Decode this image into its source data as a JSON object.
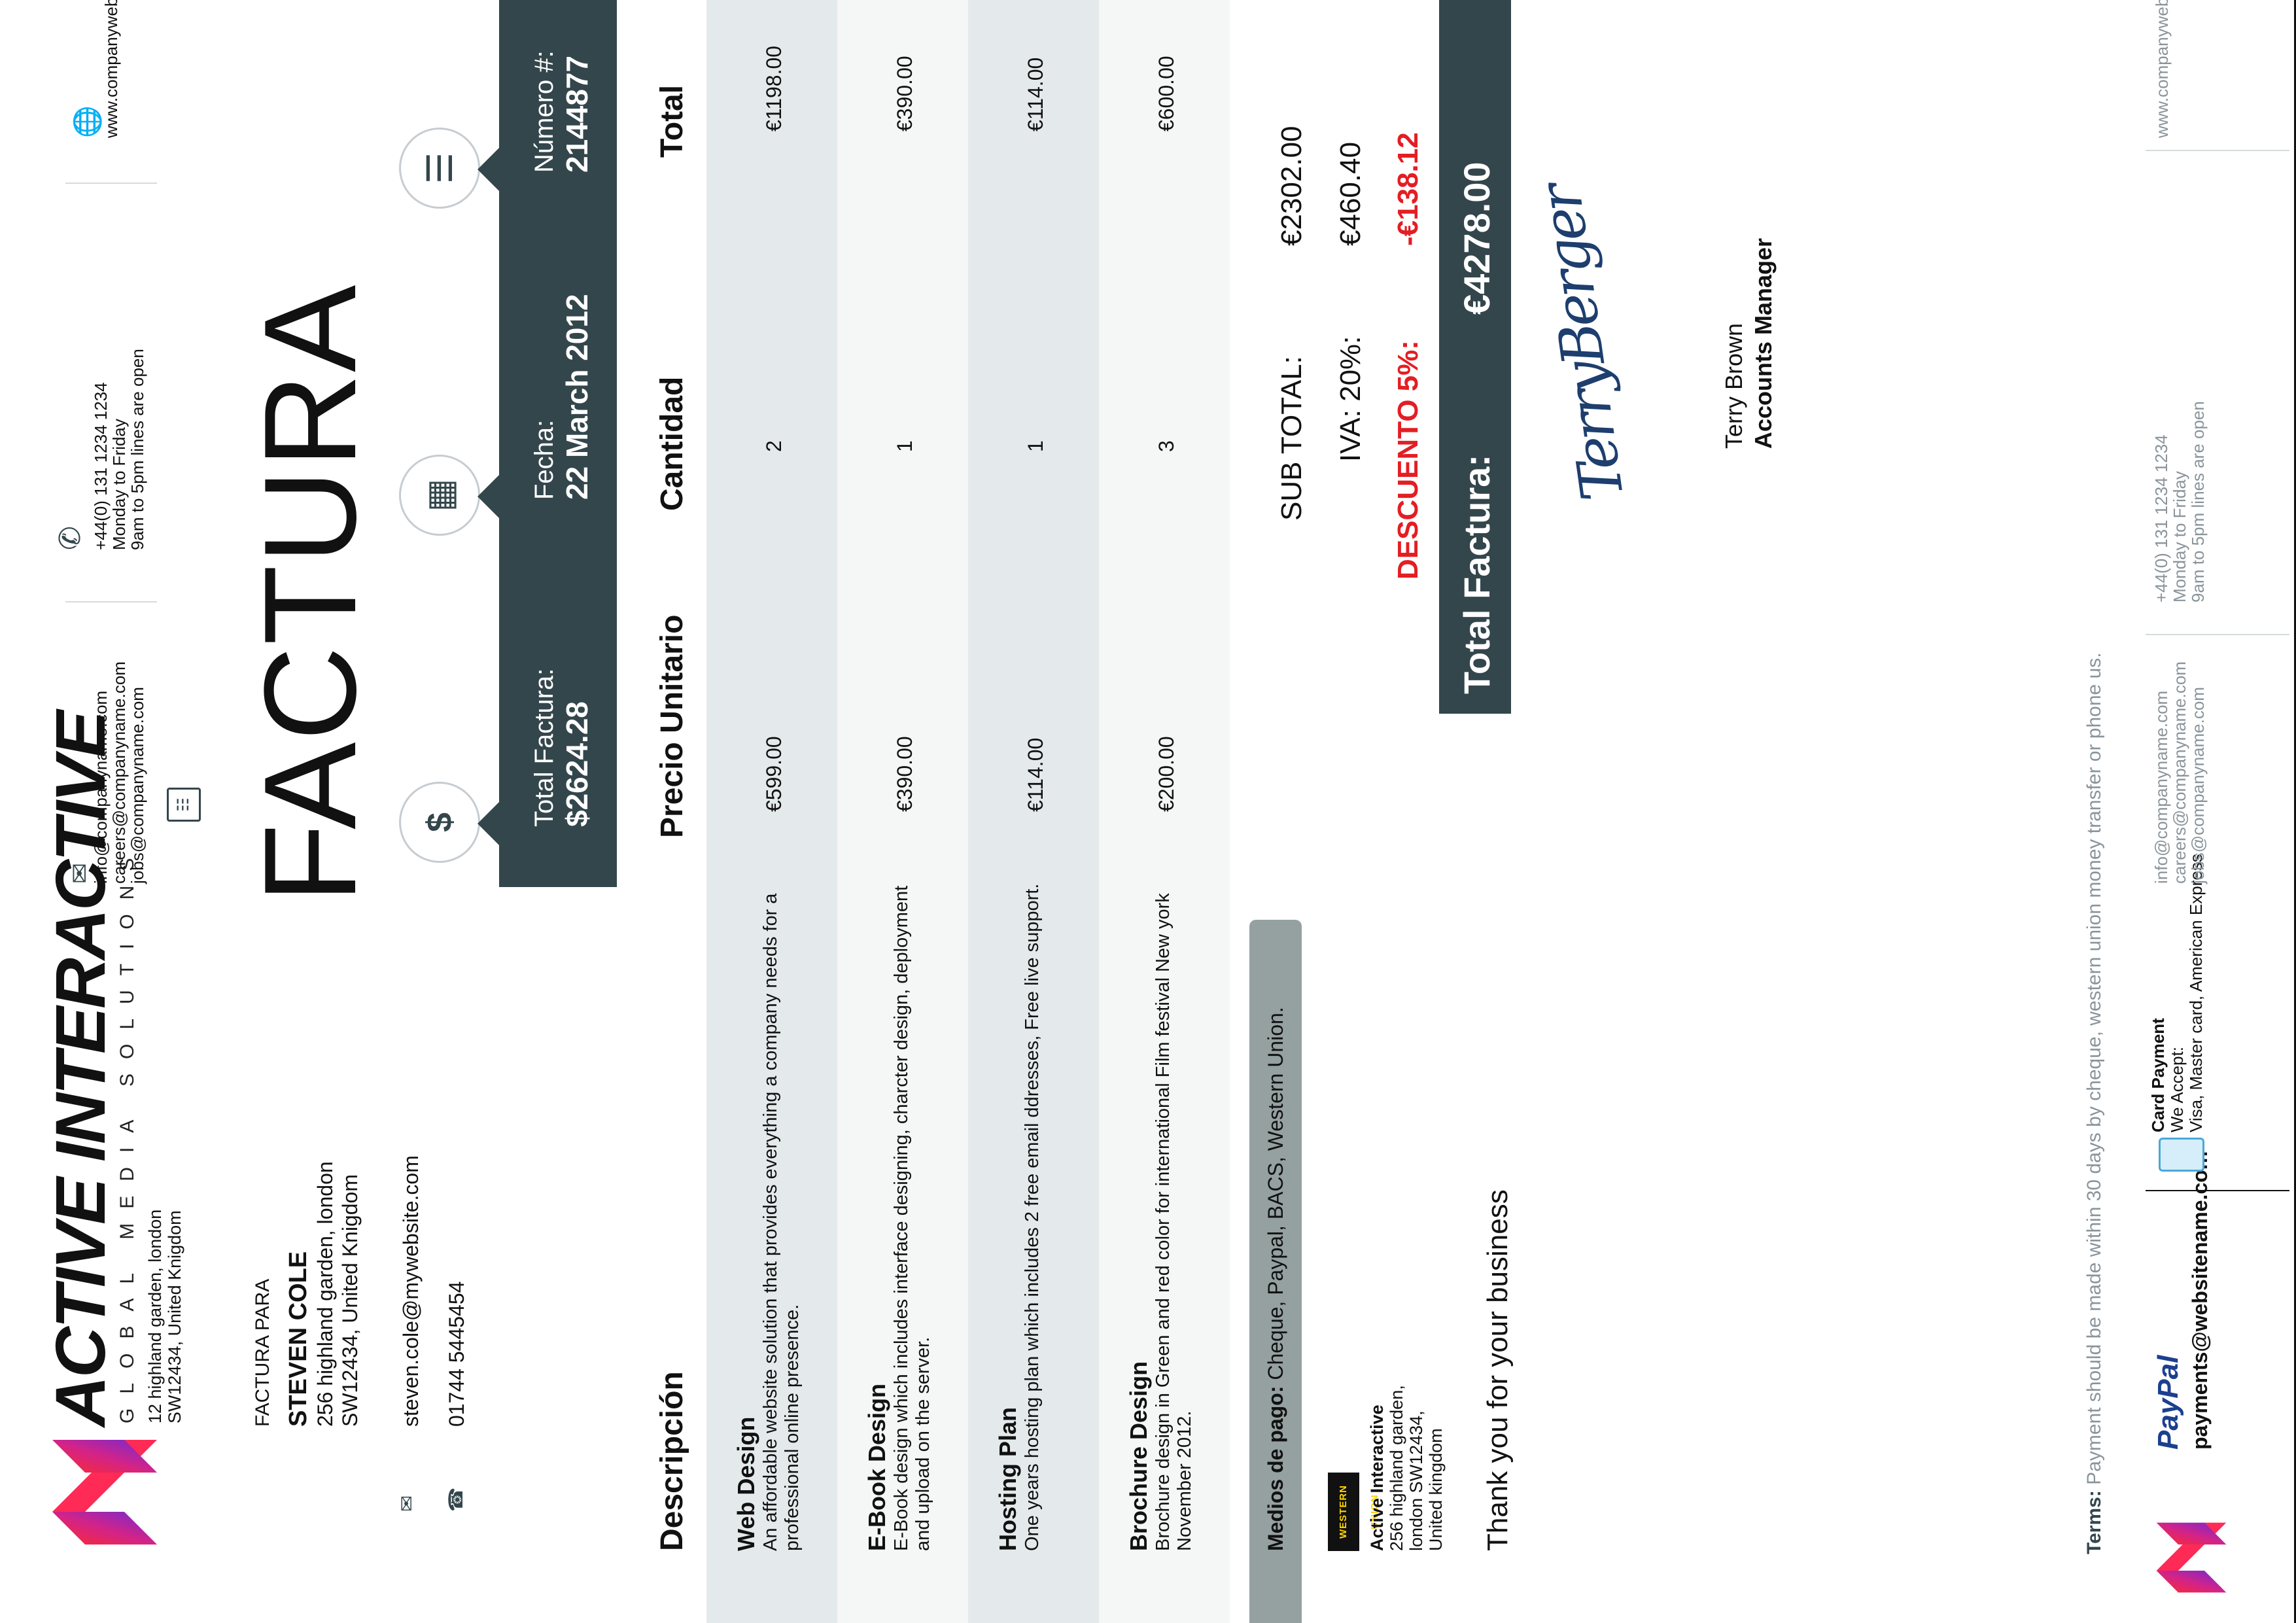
{
  "company": {
    "name": "ACTIVE INTERACTIVE",
    "tagline": "GLOBAL MEDIA SOLUTIONS",
    "address_line1": "12 highland garden, london",
    "address_line2": "SW12434, United Knigdom"
  },
  "contacts": {
    "emails": [
      "info@companyname.com",
      "careers@companyname.com",
      "jobs@companyname.com"
    ],
    "phone": [
      "+44(0) 131 1234 1234",
      "Monday to Friday",
      "9am to 5pm lines are open"
    ],
    "website": "www.companywebsite.com"
  },
  "bill_to": {
    "label": "FACTURA PARA",
    "name": "STEVEN COLE",
    "address_line1": "256 highland garden, london",
    "address_line2": "SW12434, United Knigdom",
    "email": "steven.cole@mywebsite.com",
    "phone": "01744 5445454"
  },
  "invoice": {
    "title": "FACTURA",
    "total_label": "Total Factura:",
    "total_value": "$2624.28",
    "date_label": "Fecha:",
    "date_value": "22 March 2012",
    "number_label": "Número #:",
    "number_value": "2144877"
  },
  "table": {
    "headers": [
      "Descripción",
      "Precio Unitario",
      "Cantidad",
      "Total"
    ],
    "rows": [
      {
        "title": "Web Design",
        "text": "An affordable website solution that provides everything a company needs for a professional online presence.",
        "price": "€599.00",
        "qty": "2",
        "total": "€1198.00"
      },
      {
        "title": "E-Book Design",
        "text": "E-Book design which includes interface designing, charcter design, deployment and upload on the server.",
        "price": "€390.00",
        "qty": "1",
        "total": "€390.00"
      },
      {
        "title": "Hosting Plan",
        "text": "One years hosting plan which includes 2 free email ddresses, Free live support.",
        "price": "€114.00",
        "qty": "1",
        "total": "€114.00"
      },
      {
        "title": "Brochure Design",
        "text": "Brochure design in Green and red color for international Film festival New york November 2012.",
        "price": "€200.00",
        "qty": "3",
        "total": "€600.00"
      }
    ]
  },
  "payment": {
    "label": "Medios de pago:",
    "methods": "Cheque, Paypal, BACS, Western Union.",
    "wu_logo_text": "WESTERN UNION",
    "wu_name": "Active Interactive",
    "wu_address": [
      "256 highland garden,",
      "london SW12434,",
      "United kingdom"
    ]
  },
  "totals": {
    "subtotal_label": "SUB TOTAL:",
    "subtotal_value": "€2302.00",
    "iva_label": "IVA: 20%:",
    "iva_value": "€460.40",
    "discount_label": "DESCUENTO 5%:",
    "discount_value": "-€138.12",
    "grand_label": "Total Factura:",
    "grand_value": "€4278.00"
  },
  "signature": {
    "script": "TerryBerger",
    "name": "Terry Brown",
    "role": "Accounts Manager"
  },
  "thanks": "Thank you for your business",
  "terms": {
    "label": "Terms:",
    "text": "Payment should be made within 30 days by cheque, western union money transfer or phone us."
  },
  "footer": {
    "paypal_logo": "PayPal",
    "paypal_email": "payments@websitename.com",
    "card_title": "Card Payment",
    "card_accept": "We Accept:",
    "card_types": "Visa, Master card, American Express",
    "emails": [
      "info@companyname.com",
      "careers@companyname.com",
      "jobs@companyname.com"
    ],
    "phone": [
      "+44(0) 131 1234 1234",
      "Monday to Friday",
      "9am to 5pm lines are open"
    ],
    "website": "www.companywebsite.com"
  },
  "colors": {
    "dark": "#33464c",
    "band_light": "#e4eaec",
    "band_lighter": "#f5f6f6",
    "discount_red": "#e31e24",
    "logo_gradient": [
      "#ff2a2a",
      "#c0218a",
      "#6b2bd6"
    ]
  }
}
